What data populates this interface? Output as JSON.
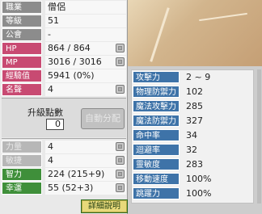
{
  "stats": [
    {
      "label": "職業",
      "value": "僧侶",
      "plus": false,
      "style": "gray"
    },
    {
      "label": "等級",
      "value": "51",
      "plus": false,
      "style": "gray"
    },
    {
      "label": "公會",
      "value": "-",
      "plus": false,
      "style": "gray"
    },
    {
      "label": "HP",
      "value": "864 / 864",
      "plus": true,
      "style": "pink"
    },
    {
      "label": "MP",
      "value": "3016 / 3016",
      "plus": true,
      "style": "pink"
    },
    {
      "label": "經驗值",
      "value": "5941 (0%)",
      "plus": false,
      "style": "pink"
    },
    {
      "label": "名聲",
      "value": "4",
      "plus": true,
      "style": "pink"
    }
  ],
  "ap": {
    "title": "升級點數",
    "value": "0",
    "auto_label": "自動分配"
  },
  "base_stats": [
    {
      "label": "力量",
      "value": "4",
      "style": "dis"
    },
    {
      "label": "敏捷",
      "value": "4",
      "style": "dis"
    },
    {
      "label": "智力",
      "value": "224 (215+9)",
      "style": "green"
    },
    {
      "label": "幸運",
      "value": "55 (52+3)",
      "style": "green"
    }
  ],
  "detail_label": "詳細說明",
  "detail_stats": [
    {
      "label": "攻擊力",
      "value": "2 ~ 9"
    },
    {
      "label": "物理防禦力",
      "value": "102"
    },
    {
      "label": "魔法攻擊力",
      "value": "285"
    },
    {
      "label": "魔法防禦力",
      "value": "327"
    },
    {
      "label": "命中率",
      "value": "34"
    },
    {
      "label": "迴避率",
      "value": "32"
    },
    {
      "label": "靈敏度",
      "value": "283"
    },
    {
      "label": "移動速度",
      "value": "100%"
    },
    {
      "label": "跳躍力",
      "value": "100%"
    }
  ]
}
